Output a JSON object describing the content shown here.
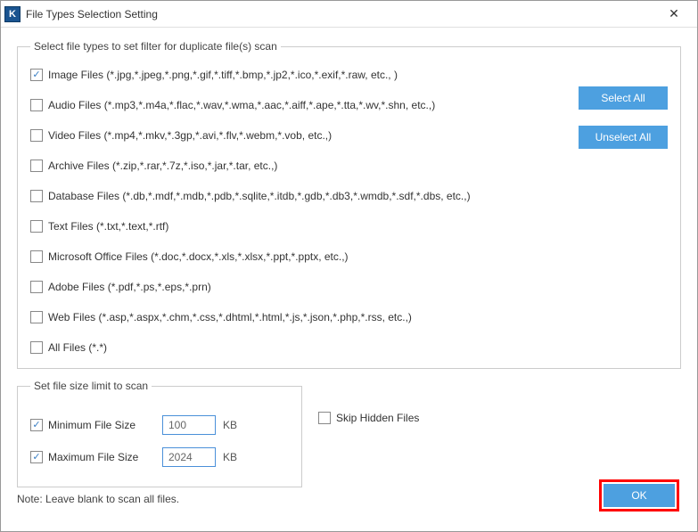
{
  "titlebar": {
    "app_icon_letter": "K",
    "title": "File Types Selection Setting"
  },
  "group_types": {
    "legend": "Select file types to set filter for duplicate file(s) scan",
    "items": [
      {
        "checked": true,
        "label": "Image Files  (*.jpg,*.jpeg,*.png,*.gif,*.tiff,*.bmp,*.jp2,*.ico,*.exif,*.raw, etc., )"
      },
      {
        "checked": false,
        "label": "Audio Files (*.mp3,*.m4a,*.flac,*.wav,*.wma,*.aac,*.aiff,*.ape,*.tta,*.wv,*.shn, etc.,)"
      },
      {
        "checked": false,
        "label": "Video Files (*.mp4,*.mkv,*.3gp,*.avi,*.flv,*.webm,*.vob, etc.,)"
      },
      {
        "checked": false,
        "label": "Archive Files (*.zip,*.rar,*.7z,*.iso,*.jar,*.tar, etc.,)"
      },
      {
        "checked": false,
        "label": "Database Files (*.db,*.mdf,*.mdb,*.pdb,*.sqlite,*.itdb,*.gdb,*.db3,*.wmdb,*.sdf,*.dbs, etc.,)"
      },
      {
        "checked": false,
        "label": "Text Files (*.txt,*.text,*.rtf)"
      },
      {
        "checked": false,
        "label": "Microsoft Office Files (*.doc,*.docx,*.xls,*.xlsx,*.ppt,*.pptx, etc.,)"
      },
      {
        "checked": false,
        "label": "Adobe Files (*.pdf,*.ps,*.eps,*.prn)"
      },
      {
        "checked": false,
        "label": "Web Files (*.asp,*.aspx,*.chm,*.css,*.dhtml,*.html,*.js,*.json,*.php,*.rss, etc.,)"
      },
      {
        "checked": false,
        "label": "All Files (*.*)"
      }
    ],
    "select_all": "Select All",
    "unselect_all": "Unselect All"
  },
  "group_size": {
    "legend": "Set file size limit to scan",
    "min": {
      "checked": true,
      "label": "Minimum File Size",
      "value": "100",
      "unit": "KB"
    },
    "max": {
      "checked": true,
      "label": "Maximum File Size",
      "value": "2024",
      "unit": "KB"
    }
  },
  "skip": {
    "checked": false,
    "label": "Skip Hidden Files"
  },
  "note": "Note: Leave blank to scan all files.",
  "ok": "OK"
}
